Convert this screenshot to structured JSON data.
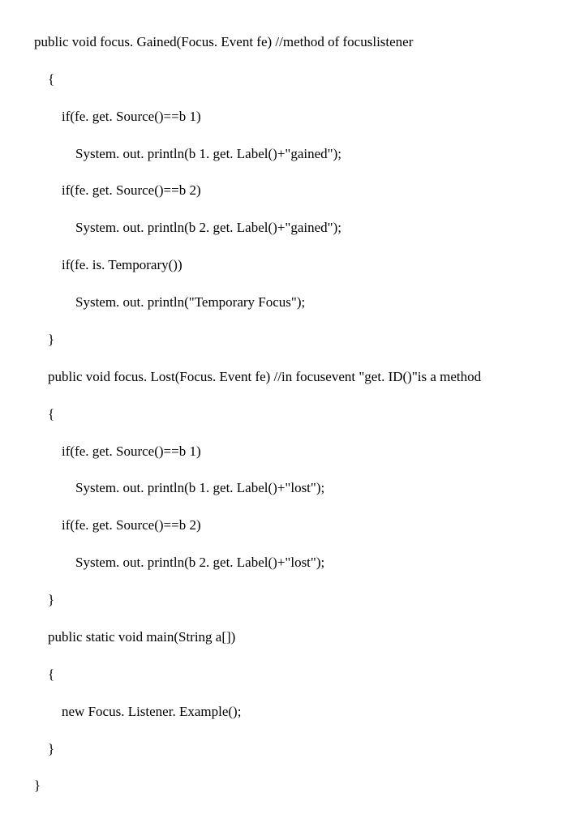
{
  "code": {
    "l01": "public void focus. Gained(Focus. Event fe) //method of focuslistener",
    "l02": "{",
    "l03": "if(fe. get. Source()==b 1)",
    "l04": "System. out. println(b 1. get. Label()+\"gained\");",
    "l05": "if(fe. get. Source()==b 2)",
    "l06": "System. out. println(b 2. get. Label()+\"gained\");",
    "l07": "if(fe. is. Temporary())",
    "l08": "System. out. println(\"Temporary Focus\");",
    "l09": "}",
    "l10": "public void focus. Lost(Focus. Event fe) //in focusevent \"get. ID()\"is a method",
    "l11": "{",
    "l12": "if(fe. get. Source()==b 1)",
    "l13": "System. out. println(b 1. get. Label()+\"lost\");",
    "l14": "if(fe. get. Source()==b 2)",
    "l15": "System. out. println(b 2. get. Label()+\"lost\");",
    "l16": "}",
    "l17": "public static void main(String a[])",
    "l18": "{",
    "l19": "new Focus. Listener. Example();",
    "l20": "}",
    "l21": "}"
  },
  "indent": {
    "i0": "",
    "i1": "    ",
    "i2": "        ",
    "i3": "            "
  }
}
